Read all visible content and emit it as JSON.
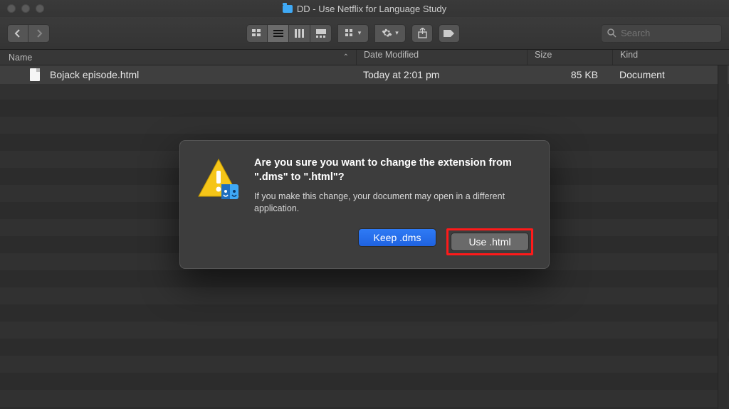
{
  "window": {
    "title": "DD - Use Netflix for Language Study"
  },
  "toolbar": {
    "search_placeholder": "Search"
  },
  "columns": {
    "name": "Name",
    "date": "Date Modified",
    "size": "Size",
    "kind": "Kind"
  },
  "files": [
    {
      "name": "Bojack episode.html",
      "date": "Today at 2:01 pm",
      "size": "85 KB",
      "kind": "Document"
    }
  ],
  "dialog": {
    "title": "Are you sure you want to change the extension from \".dms\" to \".html\"?",
    "message": "If you make this change, your document may open in a different application.",
    "keep_label": "Keep .dms",
    "use_label": "Use .html"
  }
}
